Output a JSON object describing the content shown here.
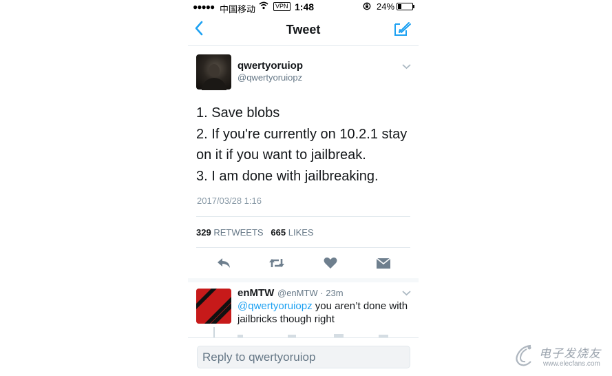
{
  "status_bar": {
    "signal": "●●●●●",
    "carrier": "中国移动",
    "vpn": "VPN",
    "time": "1:48",
    "battery_percent": "24%",
    "battery_level": 0.24
  },
  "nav": {
    "title": "Tweet",
    "back_icon": "chevron-left-icon",
    "compose_icon": "compose-icon"
  },
  "tweet": {
    "name": "qwertyoruiop",
    "handle": "@qwertyoruiopz",
    "body_lines": [
      "1. Save blobs",
      "2. If you're currently on 10.2.1 stay",
      "on it if you want to jailbreak.",
      "3. I am done with jailbreaking."
    ],
    "date": "2017/03/28 1:16",
    "retweets_count": "329",
    "retweets_label": "RETWEETS",
    "likes_count": "665",
    "likes_label": "LIKES",
    "actions": [
      "reply-icon",
      "retweet-icon",
      "like-icon",
      "message-icon"
    ]
  },
  "reply": {
    "name": "enMTW",
    "meta": "@enMTW · 23m",
    "mention": "@qwertyoruiopz",
    "text_rest": " you aren’t done with jailbricks though right"
  },
  "reply_bar": {
    "placeholder": "Reply to qwertyoruiop"
  },
  "watermark": {
    "name_cn": "电子发烧友",
    "url": "www.elecfans.com"
  },
  "colors": {
    "accent": "#1da1f2",
    "text": "#14171a",
    "muted": "#657786",
    "action_icon": "#6e7f8e",
    "divider": "#e1e8ed",
    "reply_avatar": "#c71a1a"
  }
}
